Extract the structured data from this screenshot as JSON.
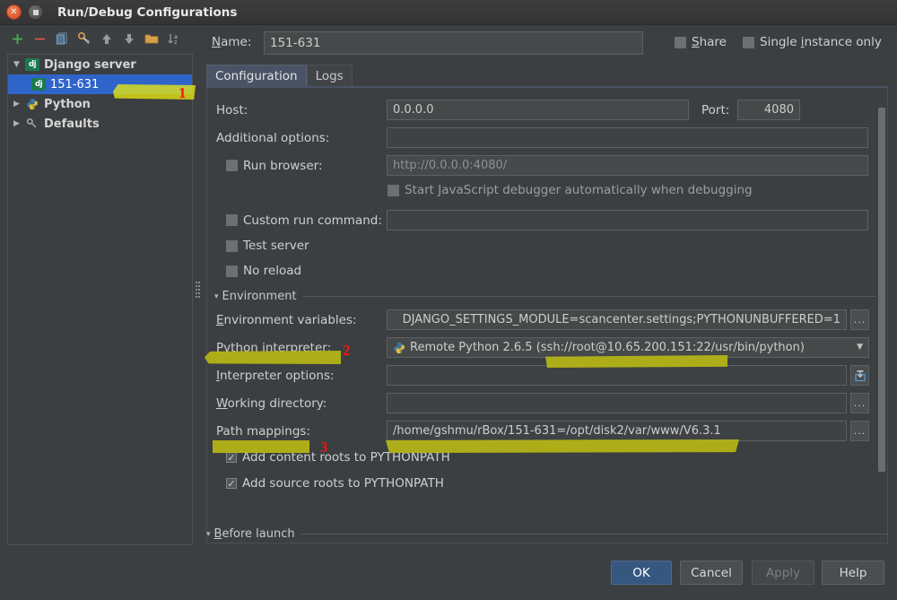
{
  "window": {
    "title": "Run/Debug Configurations",
    "close_icon": "close-icon",
    "maximize_icon": "maximize-icon"
  },
  "toolbar": {
    "buttons": [
      {
        "name": "add-configuration-button",
        "icon": "plus-icon",
        "color": "#4caf50"
      },
      {
        "name": "remove-configuration-button",
        "icon": "minus-icon",
        "color": "#d9534f"
      },
      {
        "name": "copy-configuration-button",
        "icon": "copy-icon",
        "color": "#6897bb"
      },
      {
        "name": "edit-defaults-button",
        "icon": "wrench-icon",
        "color": "#d0a24a"
      },
      {
        "name": "move-up-button",
        "icon": "arrow-up-icon",
        "color": "#9a9a9a"
      },
      {
        "name": "move-down-button",
        "icon": "arrow-down-icon",
        "color": "#9a9a9a"
      },
      {
        "name": "move-into-folder-button",
        "icon": "folder-icon",
        "color": "#d3a04a"
      },
      {
        "name": "sort-configurations-button",
        "icon": "sort-az-icon",
        "color": "#9a9a9a"
      }
    ]
  },
  "sidebar": {
    "items": [
      {
        "label": "Django server",
        "icon": "django-icon",
        "expander": "▼",
        "level": 0,
        "selected": false
      },
      {
        "label": "151-631",
        "icon": "django-icon",
        "expander": "",
        "level": 1,
        "selected": true
      },
      {
        "label": "Python",
        "icon": "python-icon",
        "expander": "▶",
        "level": 0,
        "selected": false
      },
      {
        "label": "Defaults",
        "icon": "defaults-icon",
        "expander": "▶",
        "level": 0,
        "selected": false
      }
    ]
  },
  "header": {
    "name_label": "Name:",
    "name_mnemonic": "N",
    "name_value": "151-631",
    "share_label": "Share",
    "share_checked": false,
    "single_instance_label": "Single instance only",
    "single_instance_checked": false
  },
  "tabs": [
    {
      "label": "Configuration",
      "active": true
    },
    {
      "label": "Logs",
      "active": false
    }
  ],
  "configuration": {
    "host_label": "Host:",
    "host_value": "0.0.0.0",
    "port_label": "Port:",
    "port_value": "4080",
    "additional_options_label": "Additional options:",
    "additional_options_value": "",
    "run_browser_label": "Run browser:",
    "run_browser_checked": false,
    "run_browser_url": "http://0.0.0.0:4080/",
    "js_debugger_label": "Start JavaScript debugger automatically when debugging",
    "js_debugger_checked": false,
    "custom_run_command_label": "Custom run command:",
    "custom_run_command_checked": false,
    "custom_run_command_value": "",
    "test_server_label": "Test server",
    "test_server_checked": false,
    "no_reload_label": "No reload",
    "no_reload_checked": false,
    "environment_section_label": "Environment",
    "environment_section_expander": "▾",
    "env_vars_label": "Environment variables:",
    "env_vars_mnemonic": "E",
    "env_vars_value": "DJANGO_SETTINGS_MODULE=scancenter.settings;PYTHONUNBUFFERED=1",
    "env_vars_browse": "...",
    "interpreter_label": "Python interpreter:",
    "interpreter_mnemonic": "P",
    "interpreter_value": "Remote Python 2.6.5 (ssh://root@10.65.200.151:22/usr/bin/python)",
    "interpreter_icon": "python-icon",
    "interpreter_dropdown_icon": "chevron-down-icon",
    "interpreter_options_label": "Interpreter options:",
    "interpreter_options_mnemonic": "I",
    "interpreter_options_value": "",
    "interpreter_options_button_icon": "expand-editor-icon",
    "working_directory_label": "Working directory:",
    "working_directory_mnemonic": "W",
    "working_directory_value": "",
    "working_directory_browse": "...",
    "path_mappings_label": "Path mappings:",
    "path_mappings_value": "/home/gshmu/rBox/151-631=/opt/disk2/var/www/V6.3.1",
    "path_mappings_browse": "...",
    "add_content_roots_label": "Add content roots to PYTHONPATH",
    "add_content_roots_checked": true,
    "add_source_roots_label": "Add source roots to PYTHONPATH",
    "add_source_roots_checked": true
  },
  "before_launch": {
    "label": "Before launch",
    "mnemonic": "B",
    "expander": "▾"
  },
  "footer": {
    "ok_label": "OK",
    "cancel_label": "Cancel",
    "apply_label": "Apply",
    "apply_enabled": false,
    "help_label": "Help"
  },
  "annotations": [
    {
      "number": "1",
      "target": "selected-configuration"
    },
    {
      "number": "2",
      "target": "python-interpreter"
    },
    {
      "number": "3",
      "target": "path-mappings"
    }
  ],
  "colors": {
    "background": "#3c3f41",
    "selection": "#2f65ca",
    "accent_button": "#365880",
    "highlight_marker": "#e8e80f",
    "annotation_number": "#ff1111"
  }
}
